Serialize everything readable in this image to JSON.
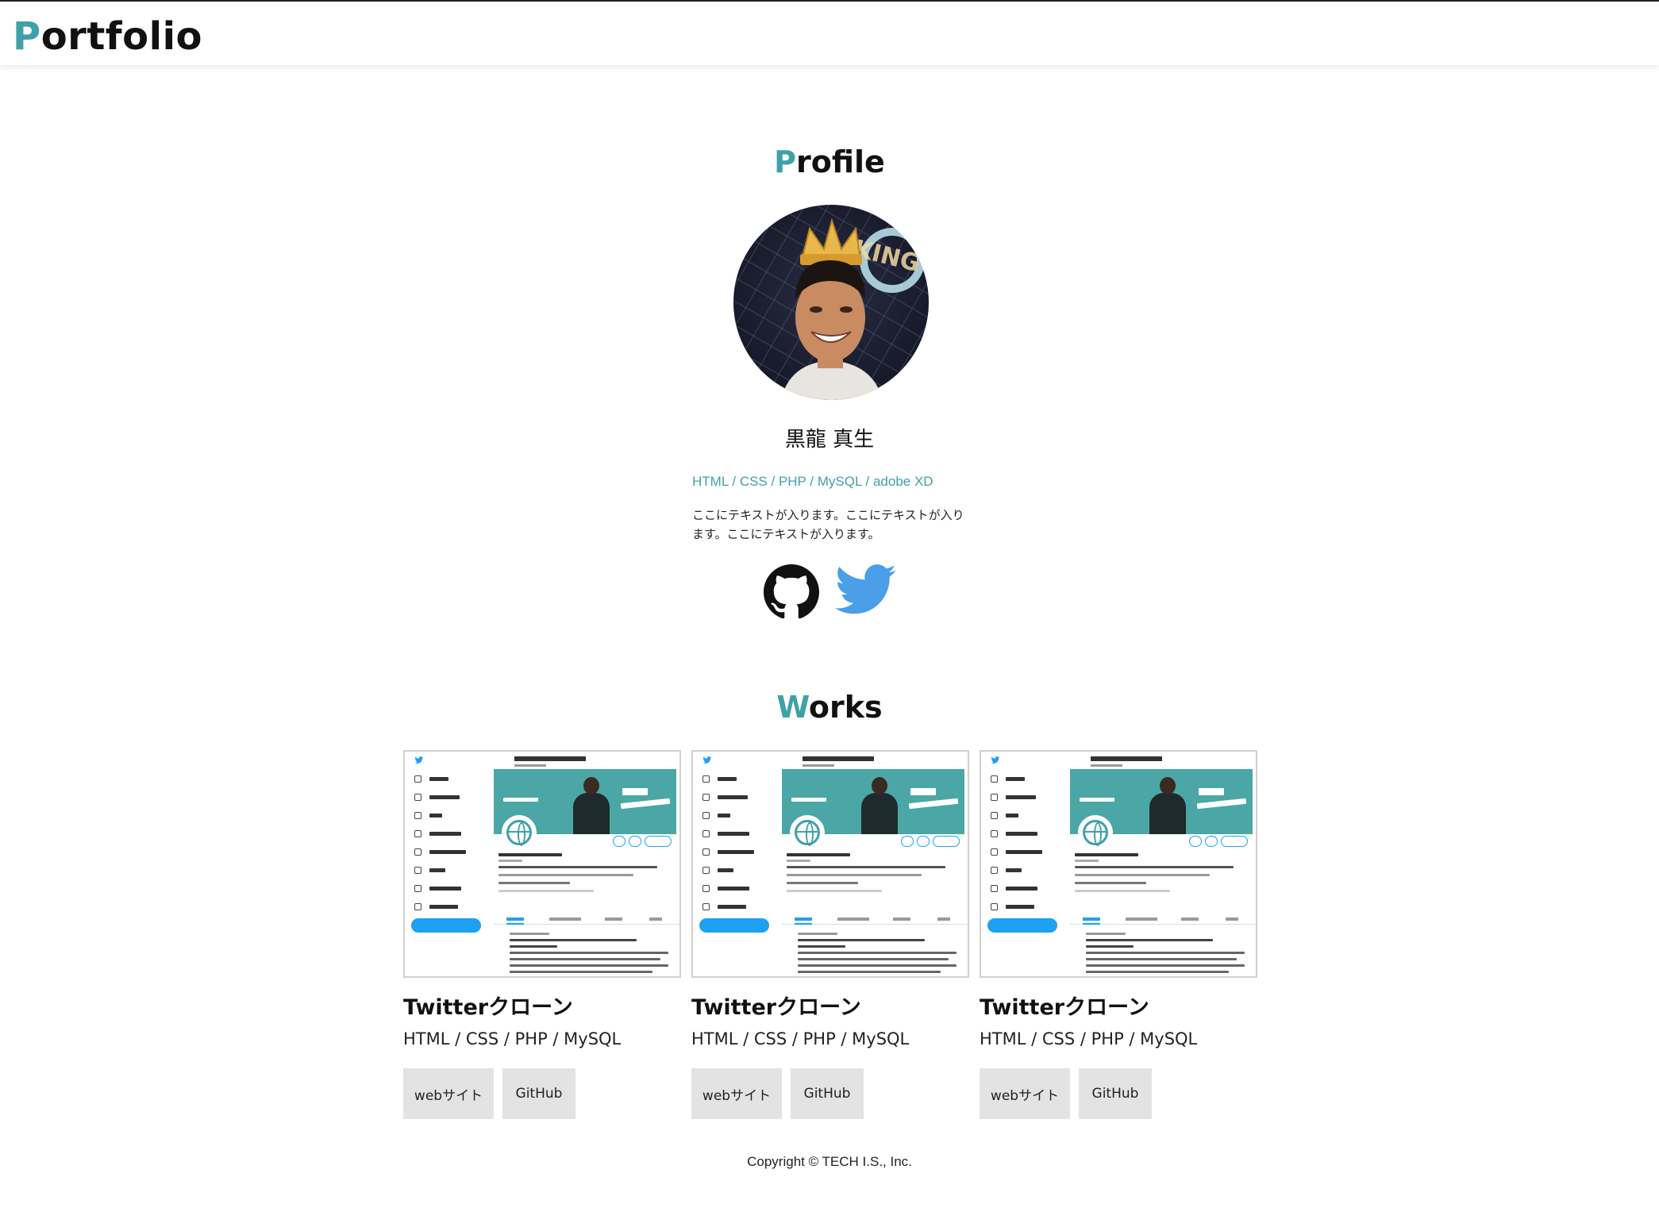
{
  "header": {
    "logo_first": "P",
    "logo_rest": "ortfolio"
  },
  "profile": {
    "title_first": "P",
    "title_rest": "rofile",
    "name": "黒龍 真生",
    "skills": "HTML / CSS / PHP / MySQL / adobe XD",
    "description": "ここにテキストが入ります。ここにテキストが入ります。ここにテキストが入ります。",
    "social": [
      {
        "icon": "github-icon"
      },
      {
        "icon": "twitter-icon"
      }
    ]
  },
  "works": {
    "title_first": "W",
    "title_rest": "orks",
    "items": [
      {
        "title": "Twitterクローン",
        "tech": "HTML / CSS / PHP / MySQL",
        "web_label": "webサイト",
        "github_label": "GitHub"
      },
      {
        "title": "Twitterクローン",
        "tech": "HTML / CSS / PHP / MySQL",
        "web_label": "webサイト",
        "github_label": "GitHub"
      },
      {
        "title": "Twitterクローン",
        "tech": "HTML / CSS / PHP / MySQL",
        "web_label": "webサイト",
        "github_label": "GitHub"
      }
    ]
  },
  "footer": {
    "copyright": "Copyright © TECH I.S., Inc."
  },
  "colors": {
    "accent": "#3fa1a8",
    "twitter": "#1da1f2",
    "button_bg": "#e3e3e3"
  }
}
